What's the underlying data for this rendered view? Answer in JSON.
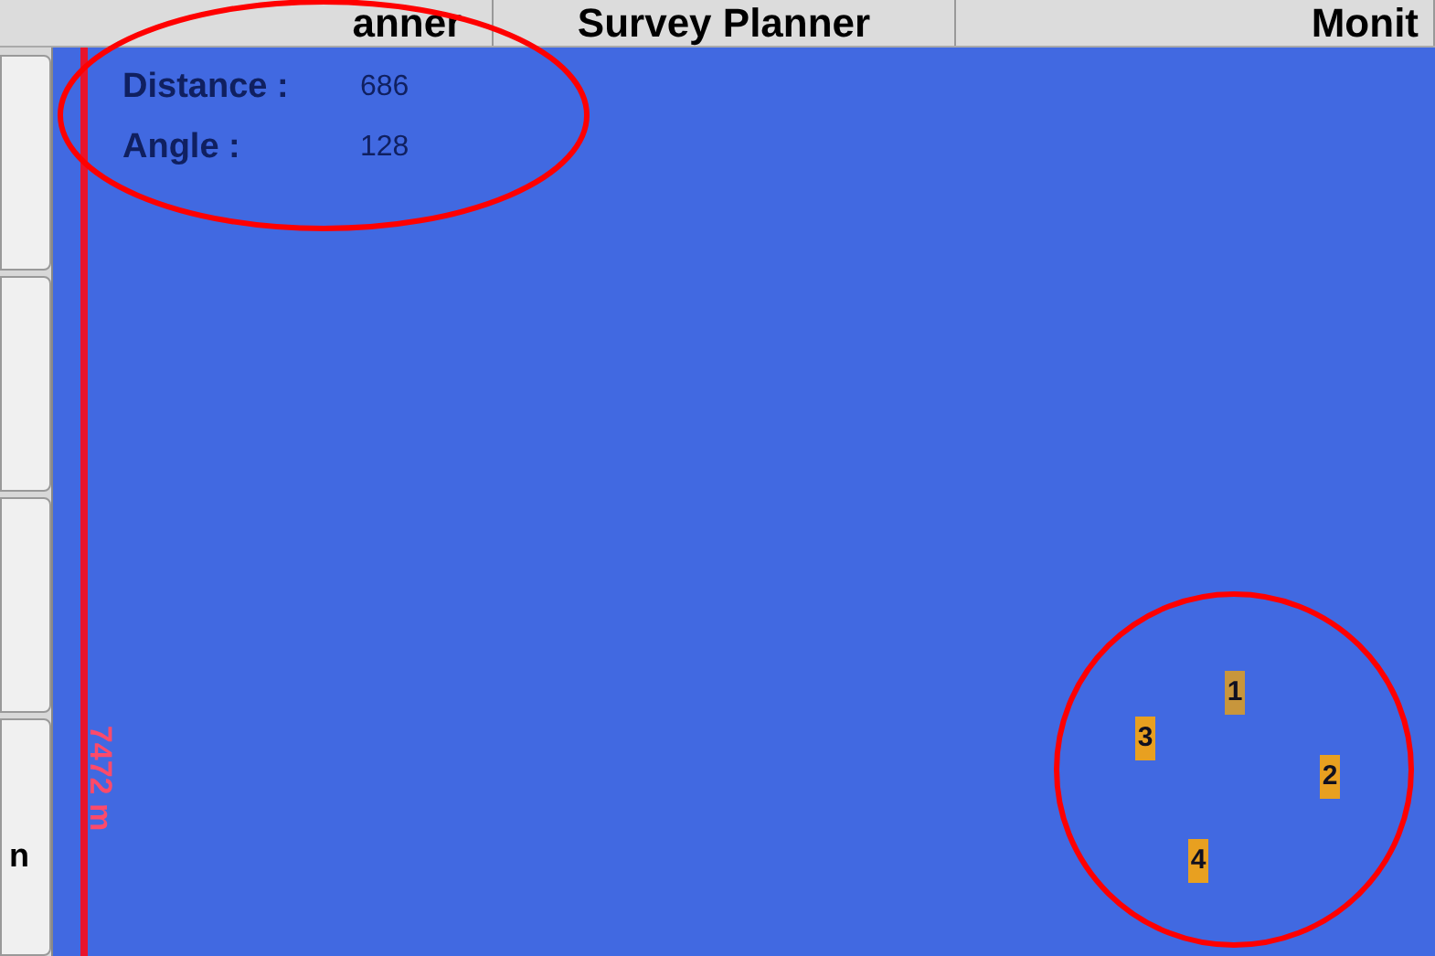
{
  "tabs": [
    {
      "label": "anner",
      "selected": false
    },
    {
      "label": "Survey Planner",
      "selected": false
    },
    {
      "label": "Monit",
      "selected": false
    }
  ],
  "side_buttons": [
    {
      "kind": "blank"
    },
    {
      "kind": "blank"
    },
    {
      "kind": "blank"
    },
    {
      "kind": "labeled",
      "label": "n"
    }
  ],
  "map": {
    "readouts": [
      {
        "label": "Distance :",
        "value": "686"
      },
      {
        "label": "Angle :",
        "value": "128"
      }
    ],
    "scale_label": "7472 m",
    "markers": [
      {
        "label": "1",
        "color": "#c8963c"
      },
      {
        "label": "2",
        "color": "#e8a020"
      },
      {
        "label": "3",
        "color": "#e8a020"
      },
      {
        "label": "4",
        "color": "#e8a020"
      }
    ]
  }
}
